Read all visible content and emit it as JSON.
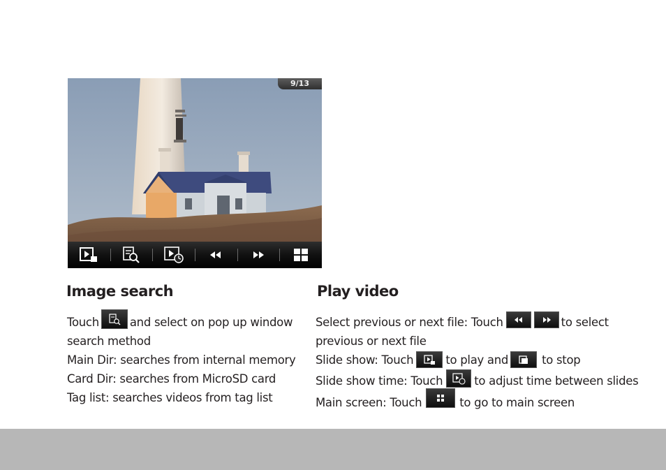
{
  "screenshot": {
    "counter": "9/13"
  },
  "image_search": {
    "heading": "Image search",
    "line1_before": "Touch",
    "line1_after": "and select on pop up window",
    "line2": "search method",
    "line3": "Main Dir: searches from internal memory",
    "line4": "Card Dir: searches from MicroSD card",
    "line5": "Tag list: searches videos from tag list"
  },
  "play_video": {
    "heading": "Play video",
    "line1_before": "Select previous or next file: Touch",
    "line1_after": "to select",
    "line2": "previous or next file",
    "line3_before": "Slide show: Touch",
    "line3_mid": "to play and",
    "line3_after": "to stop",
    "line4_before": "Slide show time: Touch",
    "line4_after": "to adjust time between slides",
    "line5_before": "Main screen: Touch",
    "line5_after": "to go to main screen"
  },
  "icons": {
    "toolbar": [
      "play-slideshow-icon",
      "search-icon",
      "slideshow-timer-icon",
      "rewind-icon",
      "fast-forward-icon",
      "grid-icon"
    ],
    "accent": "#ffffff",
    "bar": "#000000",
    "footer": "#b7b7b7"
  }
}
